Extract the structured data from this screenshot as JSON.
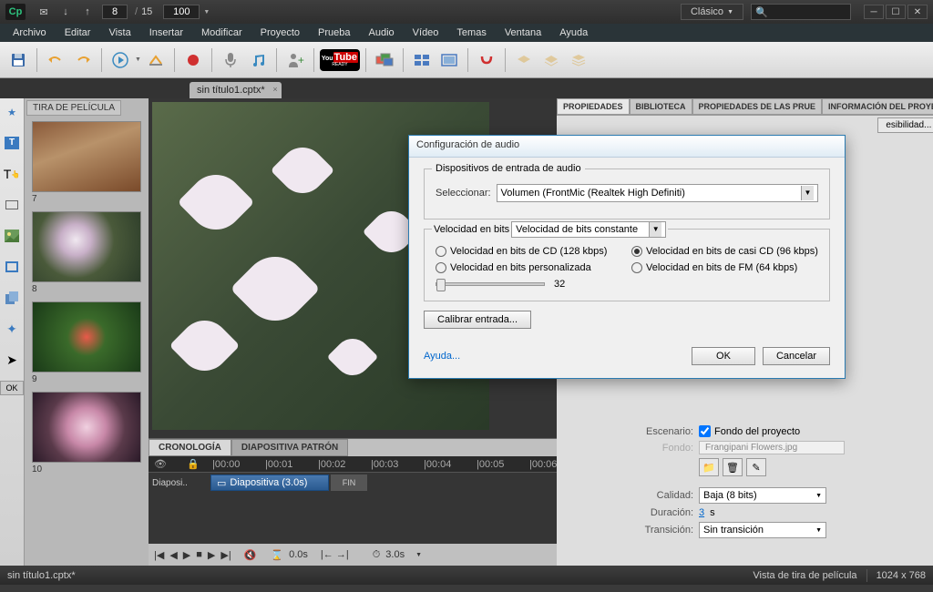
{
  "titlebar": {
    "logo": "Cp",
    "page_current": "8",
    "page_total": "15",
    "zoom": "100",
    "workspace": "Clásico"
  },
  "menu": [
    "Archivo",
    "Editar",
    "Vista",
    "Insertar",
    "Modificar",
    "Proyecto",
    "Prueba",
    "Audio",
    "Vídeo",
    "Temas",
    "Ventana",
    "Ayuda"
  ],
  "doc_tab": "sin título1.cptx*",
  "filmstrip": {
    "title": "TIRA DE PELÍCULA",
    "slides": [
      "7",
      "8",
      "9",
      "10"
    ]
  },
  "timeline": {
    "tabs": [
      "CRONOLOGÍA",
      "DIAPOSITIVA PATRÓN"
    ],
    "marks": [
      "|00:00",
      "|00:01",
      "|00:02",
      "|00:03",
      "|00:04",
      "|00:05",
      "|00:06"
    ],
    "track_label": "Diaposi..",
    "clip": "Diapositiva (3.0s)",
    "fin": "FIN",
    "time1": "0.0s",
    "time2": "3.0s"
  },
  "props": {
    "tabs": [
      "PROPIEDADES",
      "BIBLIOTECA",
      "PROPIEDADES DE LAS PRUE",
      "INFORMACIÓN DEL PROYEC"
    ],
    "access_btn": "esibilidad...",
    "escenario_label": "Escenario:",
    "escenario_check": "Fondo del proyecto",
    "fondo_label": "Fondo:",
    "fondo_value": "Frangipani Flowers.jpg",
    "calidad_label": "Calidad:",
    "calidad_value": "Baja (8 bits)",
    "duracion_label": "Duración:",
    "duracion_value": "3",
    "duracion_unit": " s",
    "transicion_label": "Transición:",
    "transicion_value": "Sin transición"
  },
  "dialog": {
    "title": "Configuración de audio",
    "fs1": "Dispositivos de entrada de audio",
    "seleccionar": "Seleccionar:",
    "device": "Volumen (FrontMic (Realtek High Definiti)",
    "fs2": "Velocidad en bits",
    "bitrate_mode": "Velocidad de bits constante",
    "r1": "Velocidad en bits de CD (128 kbps)",
    "r2": "Velocidad en bits de casi CD (96 kbps)",
    "r3": "Velocidad en bits personalizada",
    "r4": "Velocidad en bits de FM (64 kbps)",
    "slider_val": "32",
    "calibrar": "Calibrar entrada...",
    "ayuda": "Ayuda...",
    "ok": "OK",
    "cancelar": "Cancelar"
  },
  "status": {
    "file": "sin título1.cptx*",
    "view": "Vista de tira de película",
    "dims": "1024 x 768"
  }
}
